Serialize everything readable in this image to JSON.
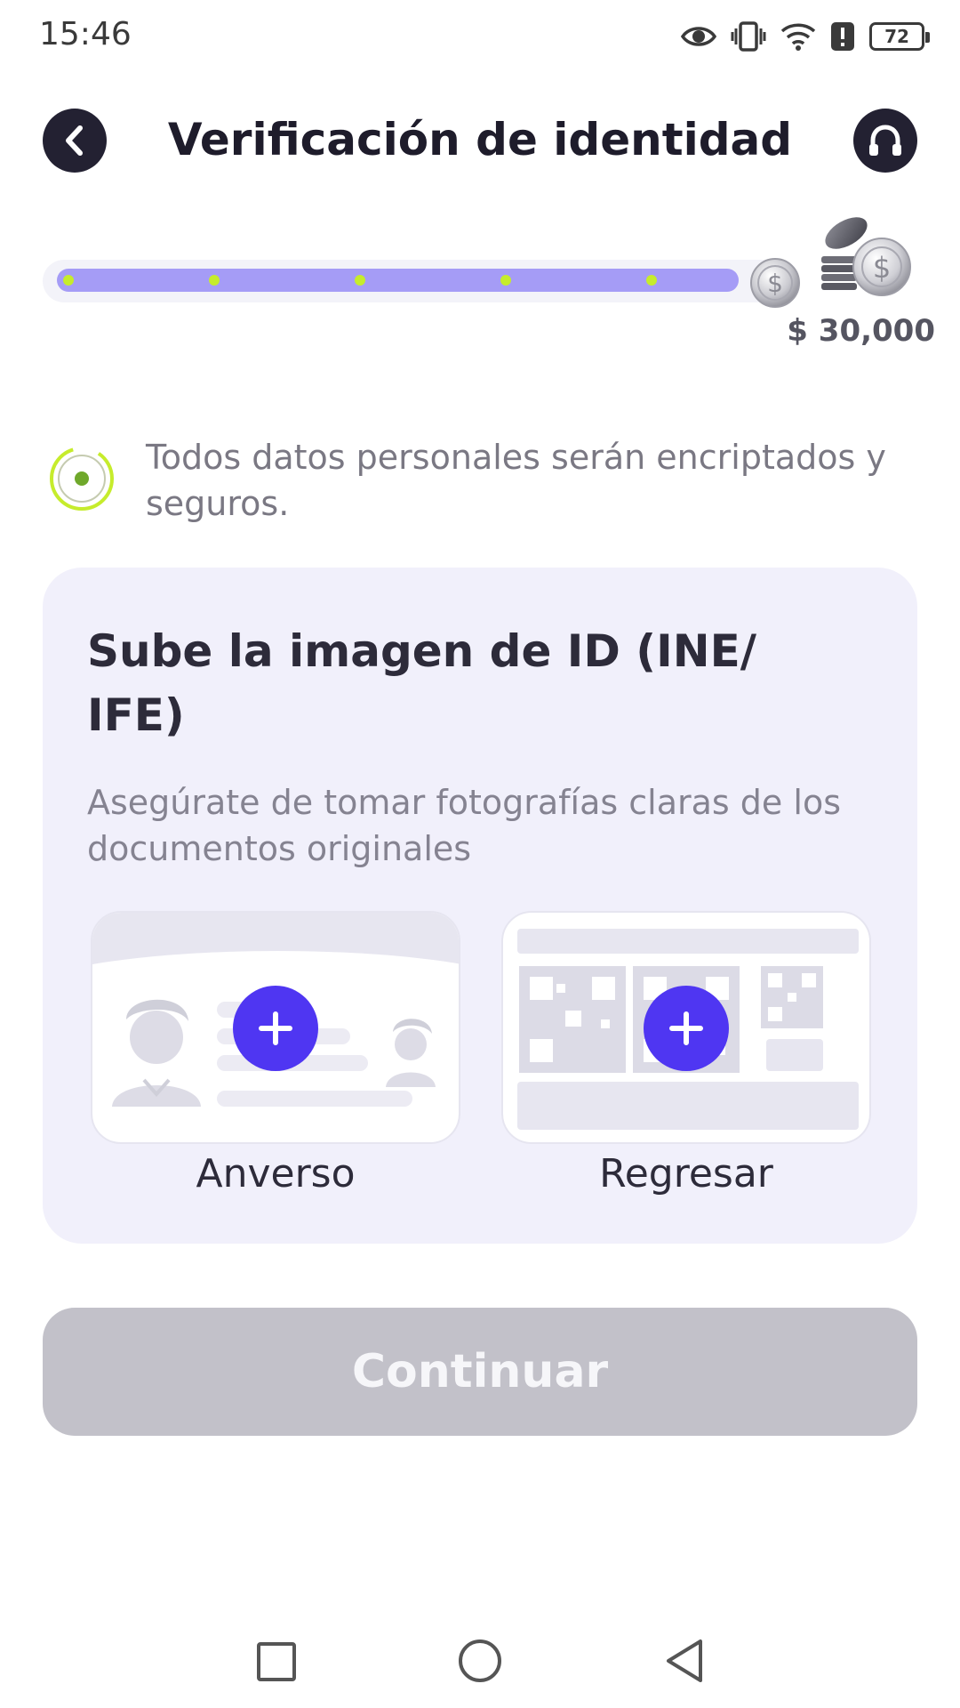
{
  "status_bar": {
    "time": "15:46",
    "battery": "72",
    "icons": [
      "eye-icon",
      "vibrate-icon",
      "wifi-icon",
      "alert-icon",
      "battery-icon"
    ]
  },
  "header": {
    "title": "Verificación de identidad",
    "back_icon": "chevron-left-icon",
    "support_icon": "headset-icon"
  },
  "progress": {
    "steps_total": 6,
    "steps_completed": 5,
    "fraction": 0.92,
    "reward": "$ 30,000",
    "colors": {
      "fill": "#a59cf6",
      "dot": "#c6ec2c",
      "track": "#f3f3f9"
    }
  },
  "security_note": "Todos datos personales serán encriptados y seguros.",
  "upload": {
    "title": "Sube la imagen de ID (INE/ IFE)",
    "subtitle": "Asegúrate de tomar fotografías claras de los documentos originales",
    "front_label": "Anverso",
    "back_label": "Regresar",
    "accent": "#4f36f2"
  },
  "continue_label": "Continuar",
  "navbar": [
    "recent-apps-icon",
    "home-icon",
    "back-icon"
  ]
}
